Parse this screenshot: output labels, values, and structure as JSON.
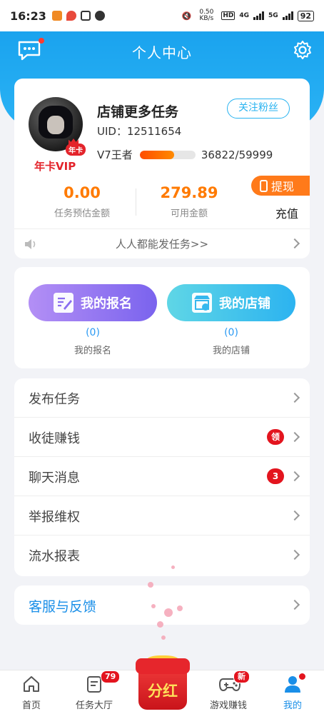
{
  "status_bar": {
    "time": "16:23",
    "net_speed": "0.50 KB/s",
    "hd": "HD",
    "net1": "4G",
    "net2": "5G",
    "battery": "92"
  },
  "header": {
    "title": "个人中心"
  },
  "profile": {
    "name": "店铺更多任务",
    "follow_label": "关注粉丝",
    "uid": "UID：12511654",
    "vip_badge": "年卡",
    "vip_label": "年卡VIP",
    "level_name": "V7王者",
    "level_progress": "36822/59999",
    "level_fraction": 0.614,
    "estimated_amount": "0.00",
    "estimated_label": "任务预估金额",
    "available_amount": "279.89",
    "available_label": "可用金额",
    "withdraw_label": "提现",
    "recharge_label": "充值",
    "notice": "人人都能发任务>>"
  },
  "entries": [
    {
      "button": "我的报名",
      "count": "(0)",
      "label": "我的报名"
    },
    {
      "button": "我的店铺",
      "count": "(0)",
      "label": "我的店铺"
    }
  ],
  "menu": [
    {
      "label": "发布任务",
      "badge": ""
    },
    {
      "label": "收徒赚钱",
      "badge": "领"
    },
    {
      "label": "聊天消息",
      "badge": "3"
    },
    {
      "label": "举报维权",
      "badge": ""
    },
    {
      "label": "流水报表",
      "badge": ""
    }
  ],
  "service": {
    "label": "客服与反馈"
  },
  "tabbar": {
    "home": "首页",
    "tasks": "任务大厅",
    "tasks_badge": "79",
    "fenhong": "分红",
    "games": "游戏赚钱",
    "games_badge": "新",
    "mine": "我的"
  },
  "colors": {
    "header": "#1aa3ee",
    "accent_orange": "#ff7a00",
    "link_blue": "#1a8fe8",
    "badge_red": "#e3141e"
  }
}
